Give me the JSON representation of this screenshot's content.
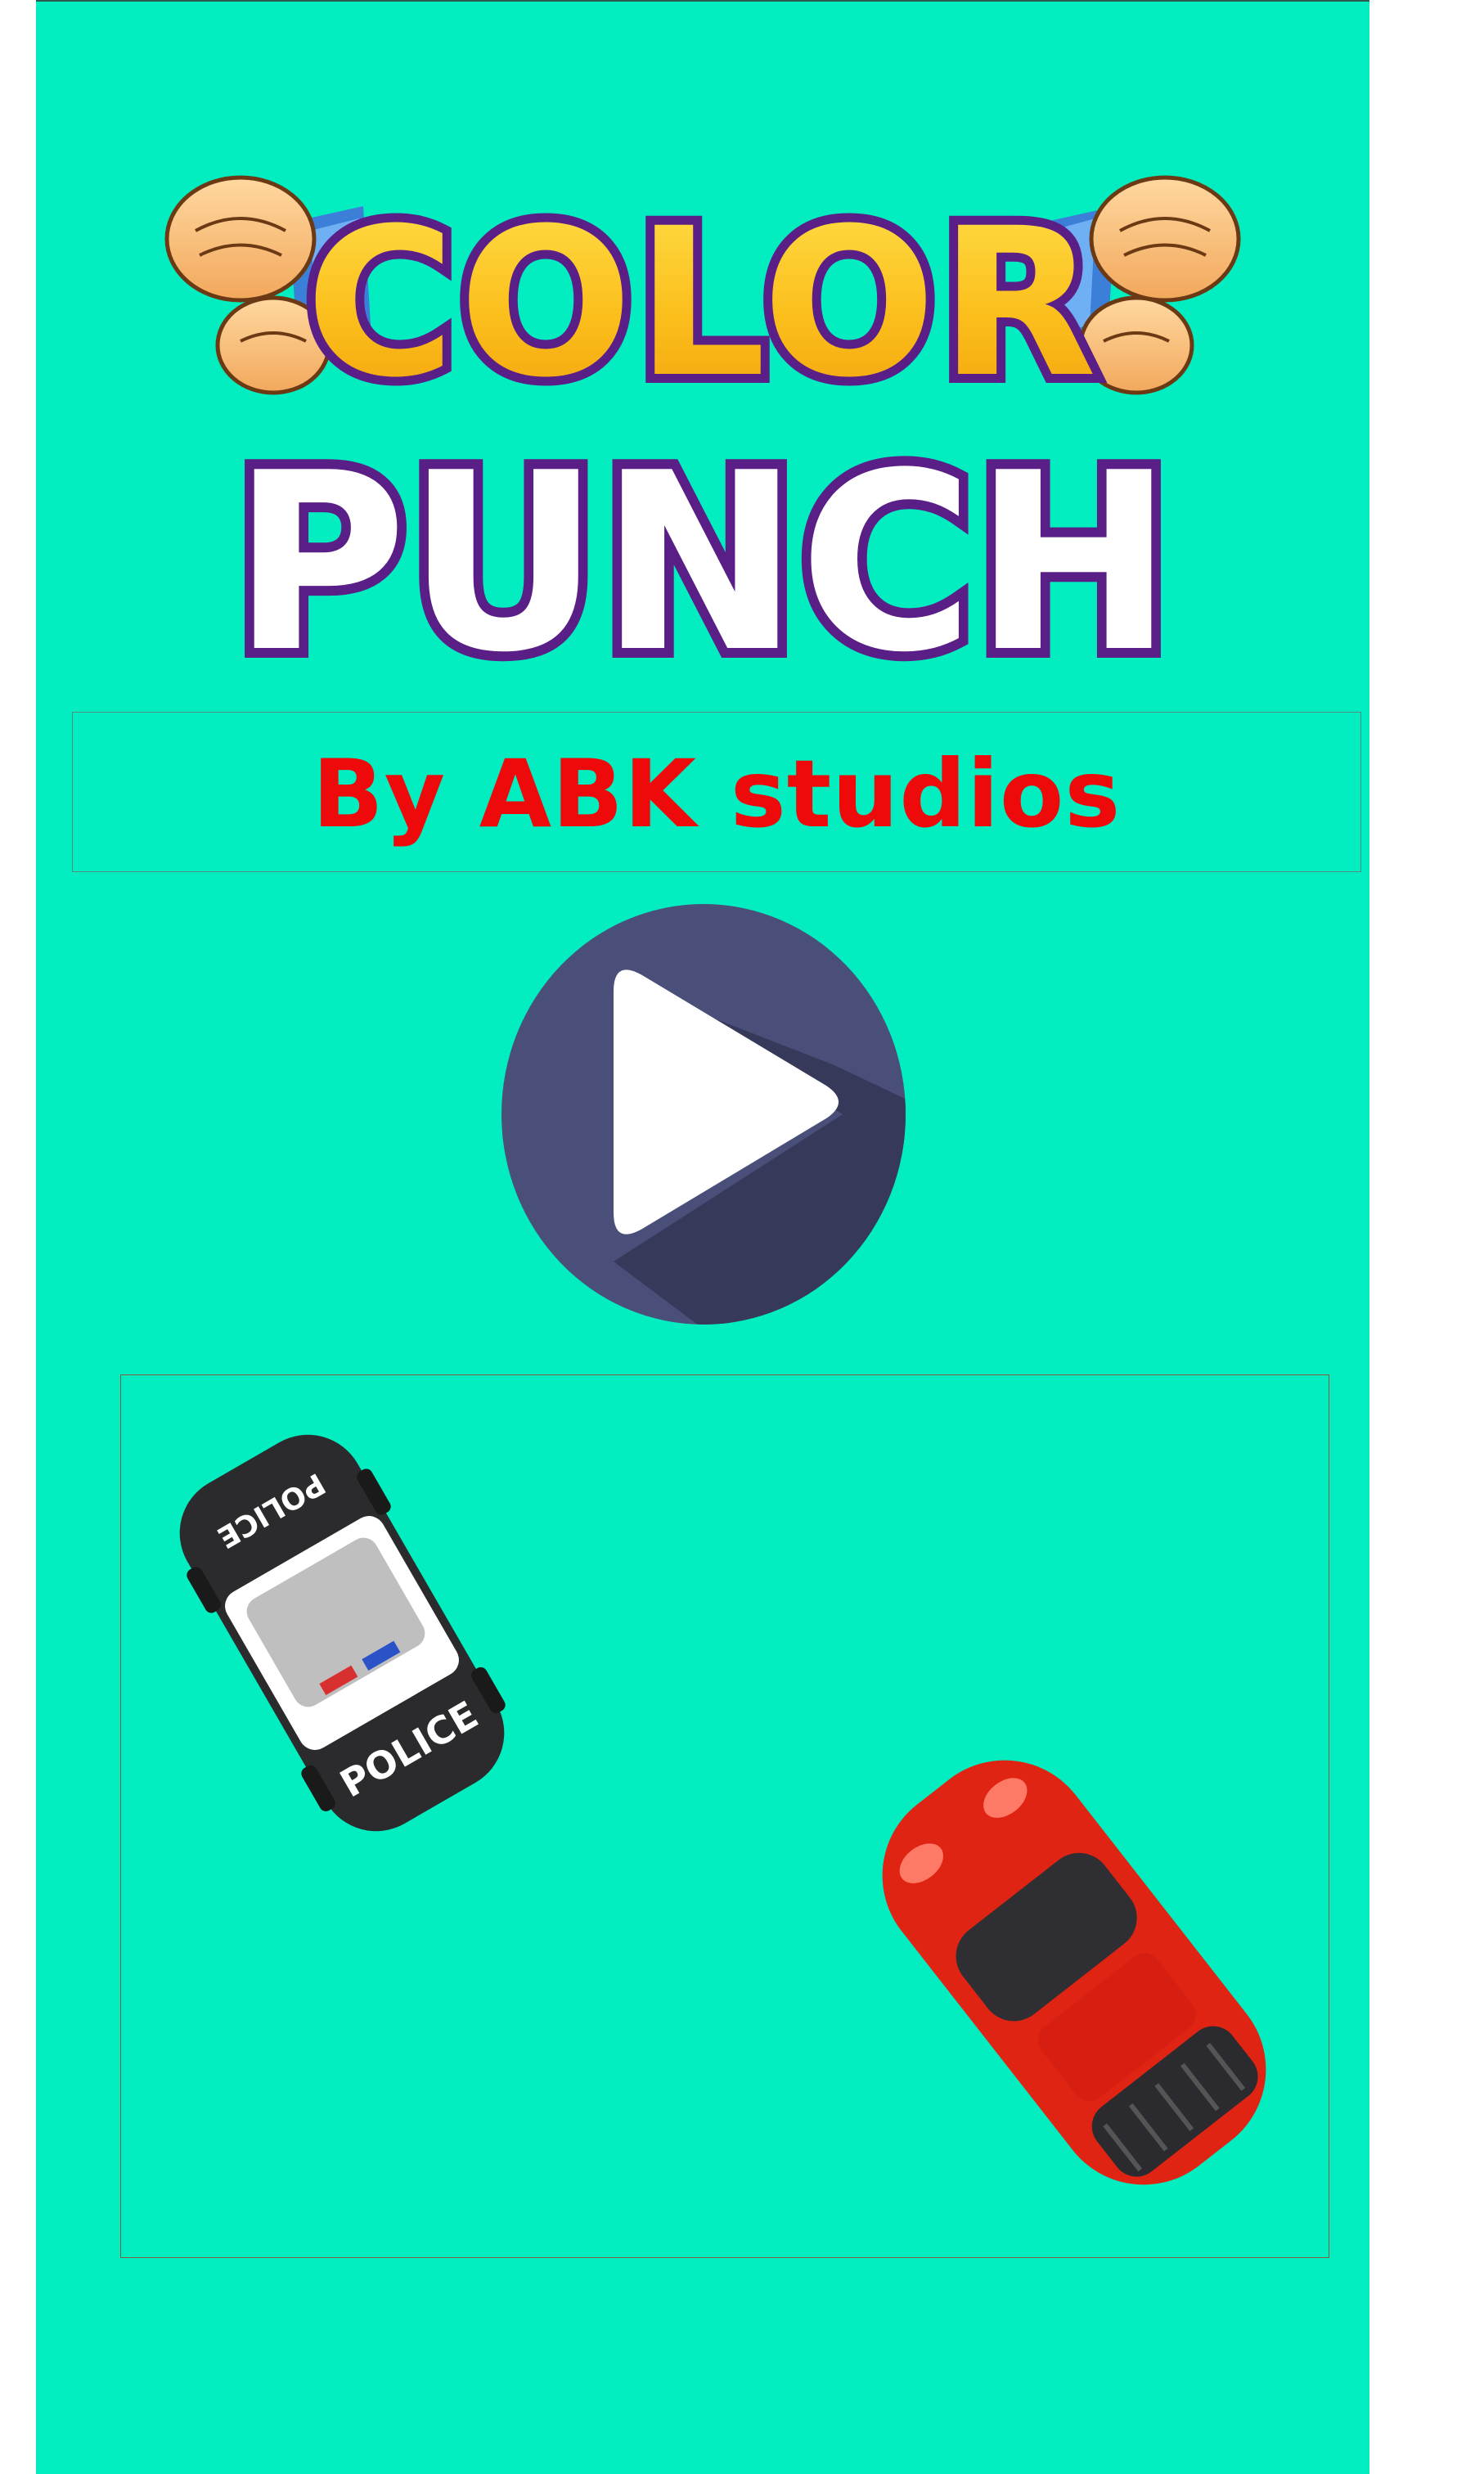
{
  "game": {
    "title_line1": "COLOR",
    "title_line2": "PUNCH",
    "credit": "By ABK studios",
    "play_icon": "play-icon",
    "colors": {
      "background": "#02edc0",
      "credit_text": "#ee0a0a",
      "title_yellow": "#fbbf1c",
      "title_outline": "#5a1f86",
      "play_circle": "#4a4f7a",
      "police_body": "#2b2b2d",
      "red_car": "#e02414"
    },
    "cars": [
      {
        "name": "police-car",
        "label": "POLICE"
      },
      {
        "name": "red-car"
      }
    ]
  }
}
